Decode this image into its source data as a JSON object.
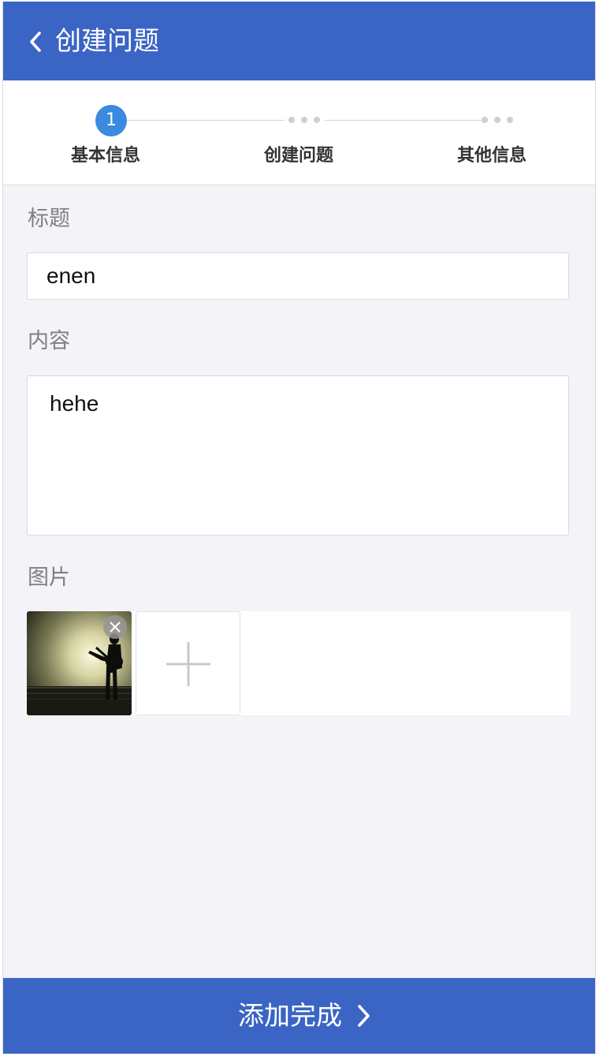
{
  "header": {
    "title": "创建问题",
    "back_icon": "chevron-left-icon",
    "color": "#3a65c4"
  },
  "steps": {
    "items": [
      {
        "label": "基本信息",
        "marker": "1",
        "state": "active"
      },
      {
        "label": "创建问题",
        "state": "pending"
      },
      {
        "label": "其他信息",
        "state": "pending"
      }
    ],
    "active_color": "#3a8ae0"
  },
  "form": {
    "title_label": "标题",
    "title_value": "enen",
    "content_label": "内容",
    "content_value": "hehe",
    "images_label": "图片",
    "images": [
      {
        "icon": "photo-thumbnail",
        "remove_icon": "close-icon"
      }
    ],
    "add_icon": "plus-icon"
  },
  "footer": {
    "submit_label": "添加完成",
    "submit_icon": "chevron-right-icon"
  }
}
